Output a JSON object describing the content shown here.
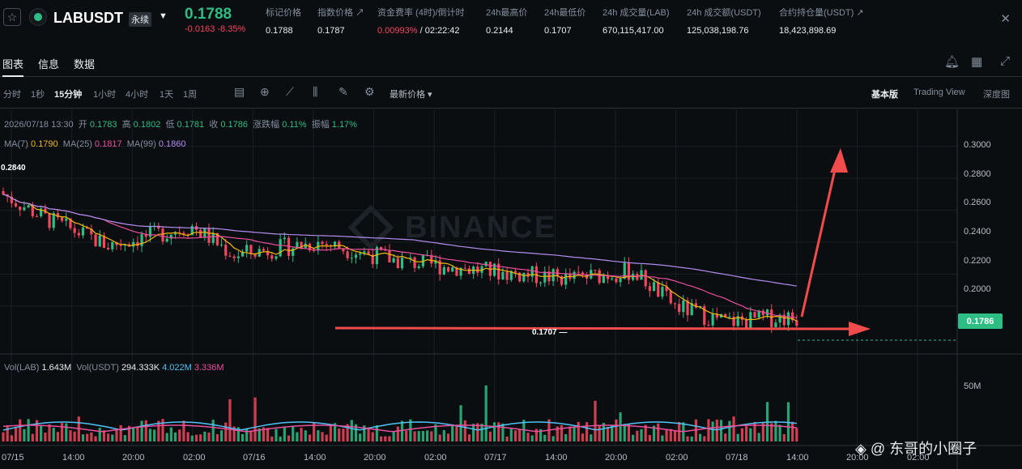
{
  "header": {
    "symbol": "LABUSDT",
    "contract_type": "永续",
    "last_price": "0.1788",
    "change": "-0.0163 -8.35%",
    "stats": [
      {
        "label": "标记价格",
        "value": "0.1788"
      },
      {
        "label": "指数价格 ↗",
        "value": "0.1787"
      },
      {
        "label": "资金费率 (4时)/倒计时",
        "value_red": "0.00993%",
        "value": " / 02:22:42"
      },
      {
        "label": "24h最高价",
        "value": "0.2144"
      },
      {
        "label": "24h最低价",
        "value": "0.1707"
      },
      {
        "label": "24h 成交量(LAB)",
        "value": "670,115,417.00"
      },
      {
        "label": "24h 成交额(USDT)",
        "value": "125,038,198.76"
      },
      {
        "label": "合约持仓量(USDT) ↗",
        "value": "18,423,898.69"
      }
    ]
  },
  "tabs": [
    {
      "label": "图表",
      "active": true
    },
    {
      "label": "信息",
      "active": false
    },
    {
      "label": "数据",
      "active": false
    }
  ],
  "tab_icons": [
    "bell-icon",
    "grid-icon",
    "expand-icon"
  ],
  "toolbar": {
    "intervals": [
      {
        "label": "分时",
        "active": false
      },
      {
        "label": "1秒",
        "active": false
      },
      {
        "label": "15分钟",
        "active": true
      },
      {
        "label": "1小时",
        "active": false
      },
      {
        "label": "4小时",
        "active": false
      },
      {
        "label": "1天",
        "active": false
      },
      {
        "label": "1周",
        "active": false
      }
    ],
    "tool_icons": [
      "calendar-icon",
      "plus-circle-icon",
      "indicator-icon",
      "candle-type-icon",
      "drawing-icon",
      "settings-icon"
    ],
    "price_type": "最新价格 ▾",
    "views": [
      {
        "label": "基本版",
        "active": true
      },
      {
        "label": "Trading View",
        "active": false
      },
      {
        "label": "深度图",
        "active": false
      }
    ]
  },
  "legend": {
    "datetime": "2026/07/18 13:30",
    "open_label": "开",
    "open": "0.1783",
    "high_label": "高",
    "high": "0.1802",
    "low_label": "低",
    "low": "0.1781",
    "close_label": "收",
    "close": "0.1786",
    "chg_label": "涨跌幅",
    "chg": "0.11%",
    "amp_label": "振幅",
    "amp": "1.17%",
    "ma7_label": "MA(7)",
    "ma7": "0.1790",
    "ma25_label": "MA(25)",
    "ma25": "0.1817",
    "ma99_label": "MA(99)",
    "ma99": "0.1860",
    "vol_lab_label": "Vol(LAB)",
    "vol_lab": "1.643M",
    "vol_usdt_label": "Vol(USDT)",
    "vol_usdt": "294.333K",
    "vol_ma1": "4.022M",
    "vol_ma2": "3.336M"
  },
  "chart_data": {
    "type": "candlestick",
    "y_ticks": [
      "0.3000",
      "0.2800",
      "0.2600",
      "0.2400",
      "0.2200",
      "0.2000"
    ],
    "ylim": [
      0.171,
      0.308
    ],
    "vol_tick": "50M",
    "x_ticks": [
      "07/15",
      "14:00",
      "20:00",
      "02:00",
      "07/16",
      "14:00",
      "20:00",
      "02:00",
      "07/17",
      "14:00",
      "20:00",
      "02:00",
      "07/18",
      "14:00",
      "20:00",
      "02:00"
    ],
    "current_price": "0.1786",
    "max_marker": "0.2840",
    "min_marker": "0.1707 —",
    "colors": {
      "up": "#2ebd85",
      "down": "#f6465d",
      "ma7": "#f0b90b",
      "ma25": "#e84f9c",
      "ma99": "#b08dee",
      "annotation": "#f24b4b"
    }
  },
  "watermark": "BINANCE",
  "credit": "◈ @ 东哥的小圈子"
}
